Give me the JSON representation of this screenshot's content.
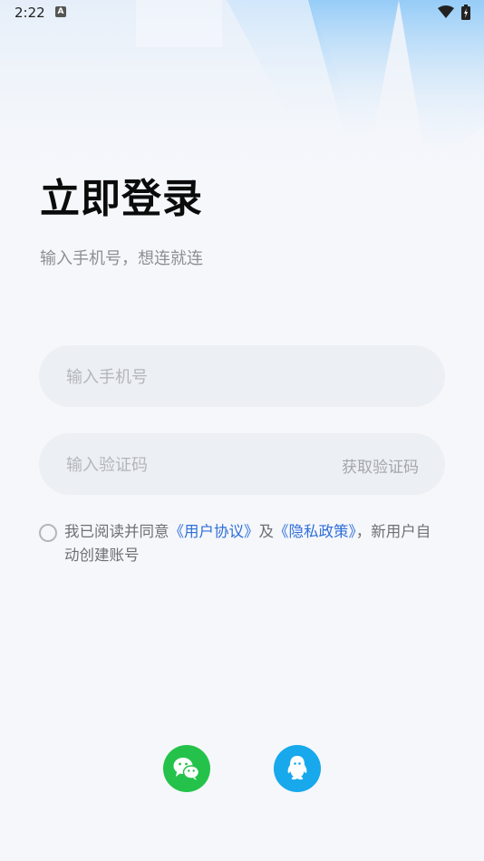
{
  "status_bar": {
    "time": "2:22",
    "notif_icon": "A"
  },
  "login": {
    "title": "立即登录",
    "subtitle": "输入手机号，想连就连",
    "phone_placeholder": "输入手机号",
    "code_placeholder": "输入验证码",
    "get_code_label": "获取验证码"
  },
  "agreement": {
    "prefix": "我已阅读并同意",
    "user_agreement": "《用户协议》",
    "and": "及",
    "privacy_policy": "《隐私政策》",
    "suffix": "，新用户自动创建账号"
  },
  "social_login": {
    "wechat_icon": "wechat-icon",
    "qq_icon": "qq-icon"
  },
  "colors": {
    "accent": "#2f6fd8",
    "wechat": "#24c24a",
    "qq": "#18a8ec",
    "background": "#f5f7fb",
    "input_bg": "#eceff3"
  }
}
